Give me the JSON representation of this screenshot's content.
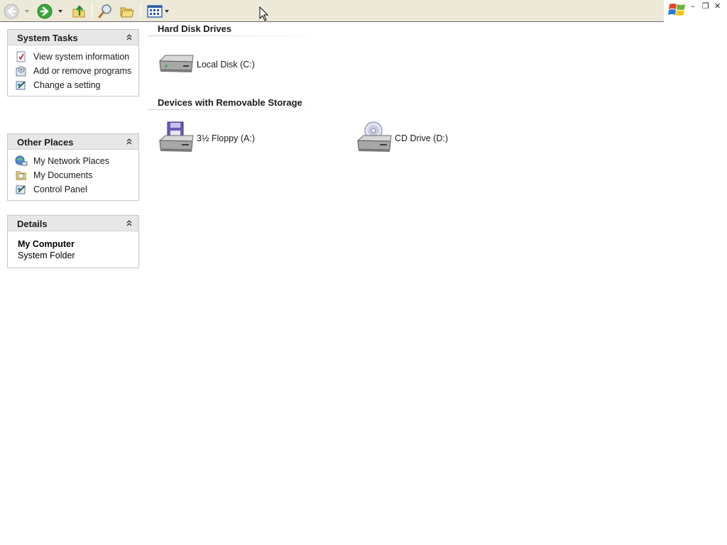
{
  "toolbar": {
    "back": "back-icon",
    "forward": "forward-icon",
    "up": "folder-up-icon",
    "search": "search-icon",
    "folders": "folders-icon",
    "views": "views-icon"
  },
  "window_controls": {
    "minimize": "–",
    "restore": "❐",
    "close": "✕"
  },
  "sidebar": {
    "system_tasks": {
      "title": "System Tasks",
      "items": [
        {
          "label": "View system information",
          "icon": "system-info-icon"
        },
        {
          "label": "Add or remove programs",
          "icon": "add-remove-programs-icon"
        },
        {
          "label": "Change a setting",
          "icon": "control-panel-icon"
        }
      ]
    },
    "other_places": {
      "title": "Other Places",
      "items": [
        {
          "label": "My Network Places",
          "icon": "network-places-icon"
        },
        {
          "label": "My Documents",
          "icon": "my-documents-icon"
        },
        {
          "label": "Control Panel",
          "icon": "control-panel-icon"
        }
      ]
    },
    "details": {
      "title": "Details",
      "name": "My Computer",
      "type": "System Folder"
    }
  },
  "main": {
    "groups": [
      {
        "title": "Hard Disk Drives",
        "items": [
          {
            "label": "Local Disk (C:)",
            "icon": "hard-disk-icon"
          }
        ]
      },
      {
        "title": "Devices with Removable Storage",
        "items": [
          {
            "label": "3½ Floppy (A:)",
            "icon": "floppy-drive-icon"
          },
          {
            "label": "CD Drive (D:)",
            "icon": "cd-drive-icon"
          }
        ]
      }
    ]
  },
  "colors": {
    "toolbar_bg": "#ece9d8",
    "panel_header_bg": "#e7e7e7",
    "back_arrow": "#c8c8c8",
    "forward_arrow": "#2e9b2e"
  }
}
